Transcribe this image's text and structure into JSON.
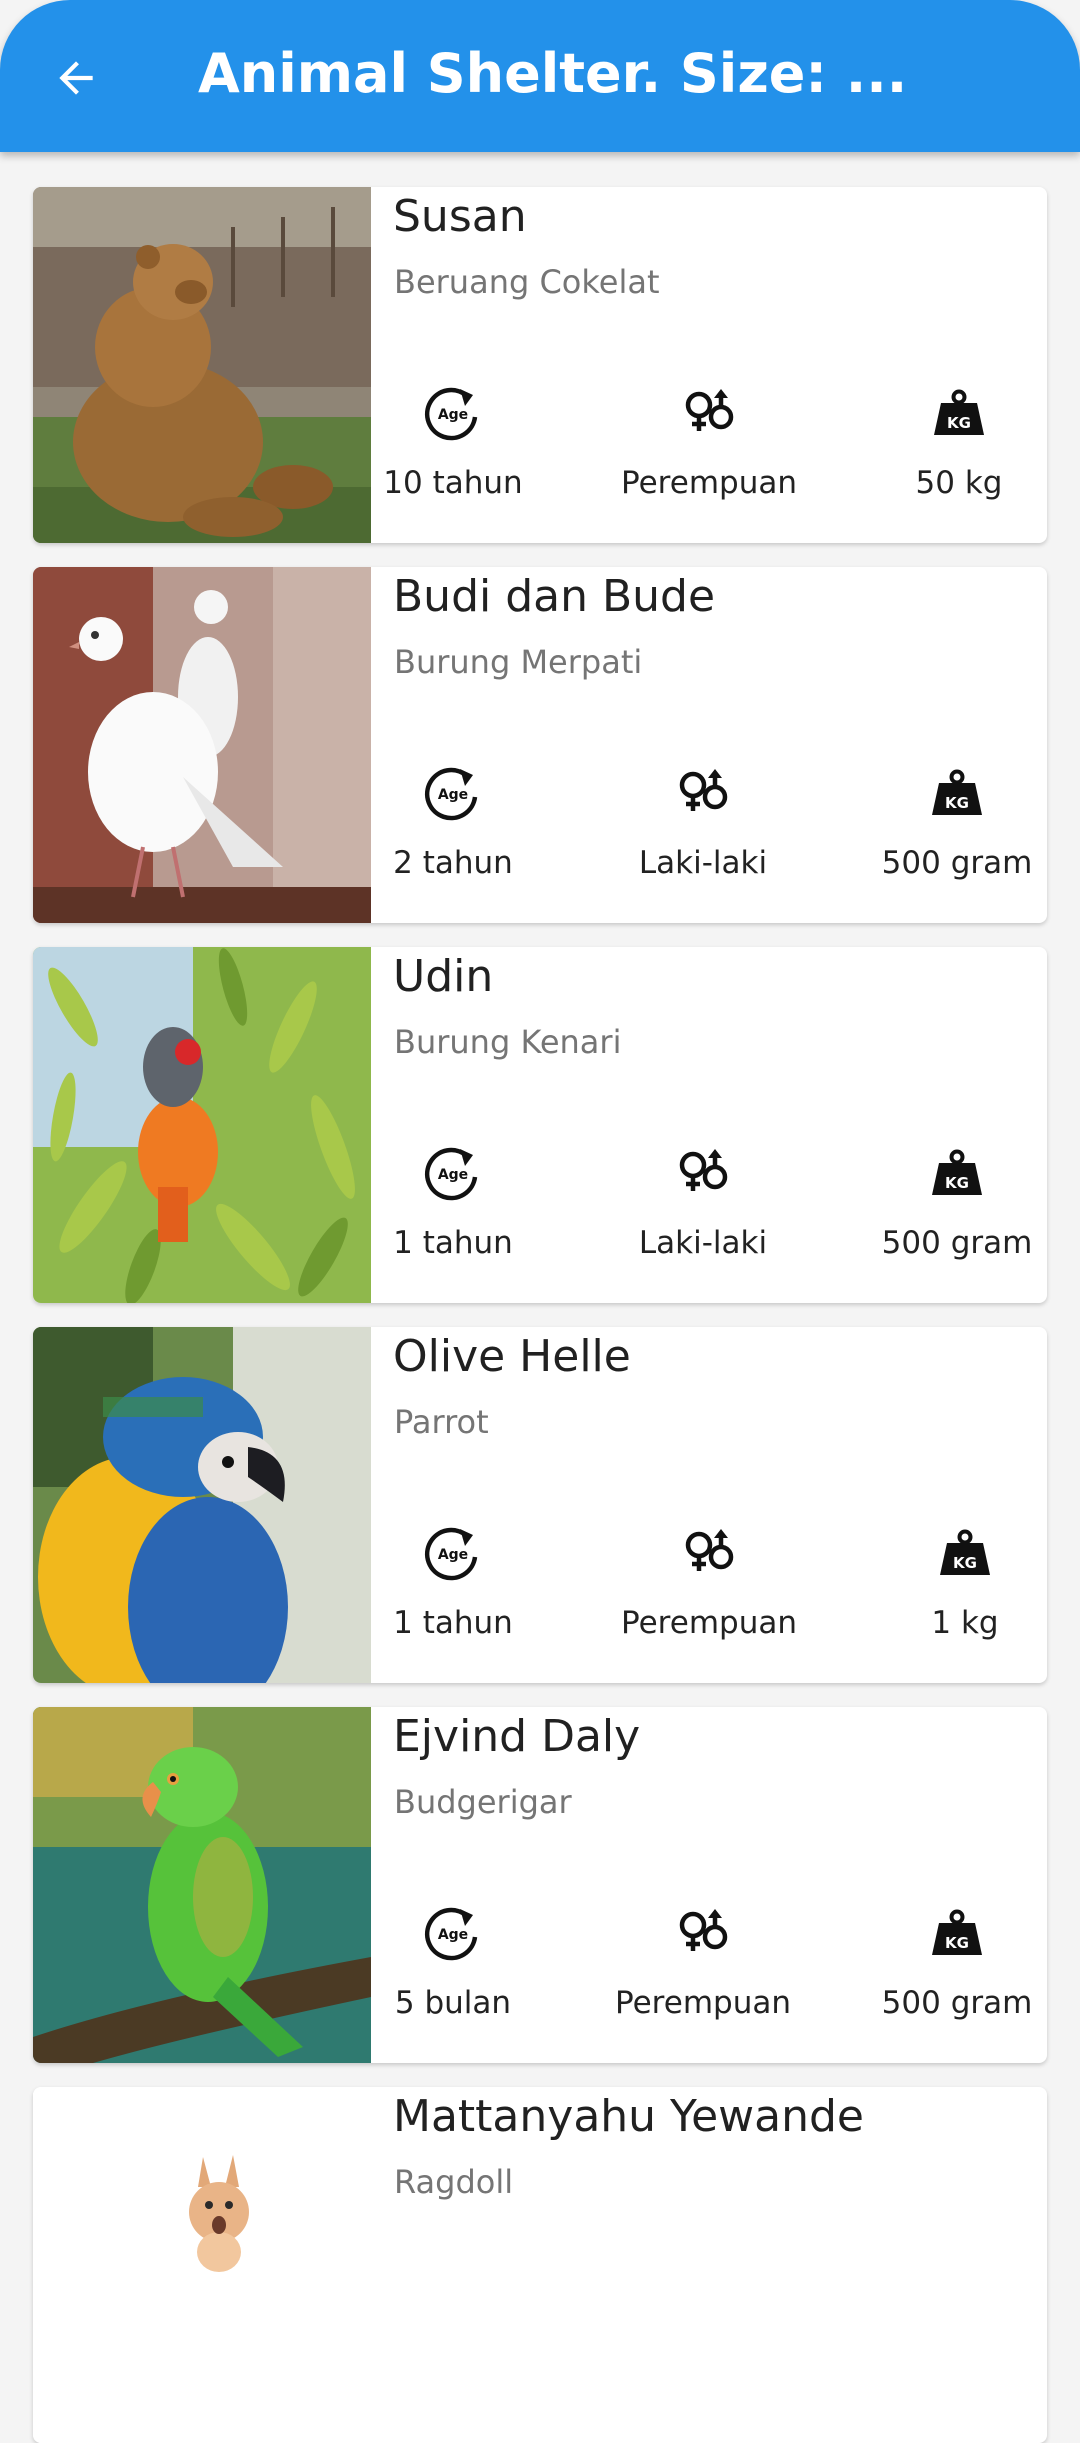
{
  "app_bar": {
    "title": "Animal Shelter. Size: ...",
    "back_icon": "arrow-left-icon",
    "color": "#2391ea"
  },
  "icons": {
    "age": "age-icon",
    "gender": "gender-icon",
    "weight": "weight-kg-icon"
  },
  "animals": [
    {
      "name": "Susan",
      "breed": "Beruang Cokelat",
      "age": "10 tahun",
      "gender": "Perempuan",
      "weight": "50 kg"
    },
    {
      "name": "Budi dan Bude",
      "breed": "Burung Merpati",
      "age": "2 tahun",
      "gender": "Laki-laki",
      "weight": "500 gram"
    },
    {
      "name": "Udin",
      "breed": "Burung Kenari",
      "age": "1 tahun",
      "gender": "Laki-laki",
      "weight": "500 gram"
    },
    {
      "name": "Olive Helle",
      "breed": "Parrot",
      "age": "1 tahun",
      "gender": "Perempuan",
      "weight": "1 kg"
    },
    {
      "name": "Ejvind Daly",
      "breed": "Budgerigar",
      "age": "5 bulan",
      "gender": "Perempuan",
      "weight": "500 gram"
    },
    {
      "name": "Mattanyahu Yewande",
      "breed": "Ragdoll"
    }
  ]
}
